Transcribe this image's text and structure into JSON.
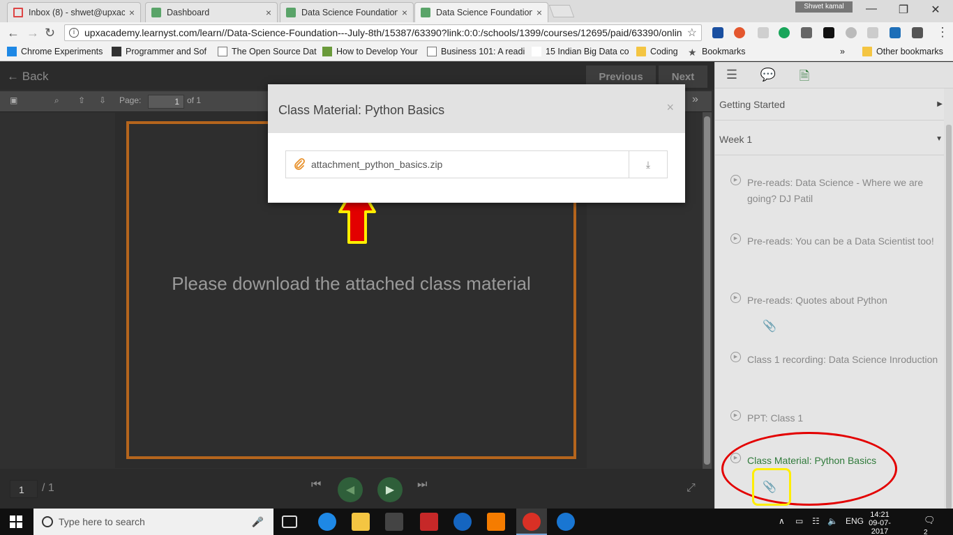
{
  "browser": {
    "tabs": [
      {
        "title": "Inbox (8) - shwet@upxac",
        "icon": "gmail-icon"
      },
      {
        "title": "Dashboard",
        "icon": "learnyst-icon"
      },
      {
        "title": "Data Science Foundation",
        "icon": "learnyst-icon"
      },
      {
        "title": "Data Science Foundation",
        "icon": "learnyst-icon"
      }
    ],
    "close_glyph": "×",
    "user_badge": "Shwet kamal",
    "url": "upxacademy.learnyst.com/learn//Data-Science-Foundation---July-8th/15387/63390?link:0:0:/schools/1399/courses/12695/paid/63390/onlin",
    "bookmarks": [
      {
        "label": "Chrome Experiments",
        "icon": "ce"
      },
      {
        "label": "Programmer and Sof",
        "icon": "dark"
      },
      {
        "label": "The Open Source Dat",
        "icon": "page"
      },
      {
        "label": "How to Develop Your",
        "icon": "hl"
      },
      {
        "label": "Business 101: A readi",
        "icon": "page"
      },
      {
        "label": "15 Indian Big Data co",
        "icon": "ys"
      },
      {
        "label": "Coding",
        "icon": "folder"
      },
      {
        "label": "Bookmarks",
        "icon": "starbm"
      }
    ],
    "bookmarks_more": "»",
    "other_bookmarks": "Other bookmarks"
  },
  "viewer": {
    "back_label": "Back",
    "previous_label": "Previous",
    "next_label": "Next",
    "page_label": "Page:",
    "page_value": "1",
    "page_of": "of 1",
    "slide_text": "Please download the attached class material",
    "bottom_page": "1",
    "bottom_of": "/ 1"
  },
  "sidebar": {
    "sections": [
      {
        "label": "Getting Started",
        "arrow": "▶"
      },
      {
        "label": "Week 1",
        "arrow": "▼"
      }
    ],
    "items": [
      {
        "label": "Pre-reads: Data Science - Where we are going? DJ Patil"
      },
      {
        "label": "Pre-reads: You can be a Data Scientist too!"
      },
      {
        "label": "Pre-reads: Quotes about Python"
      },
      {
        "label": "Class 1 recording: Data Science Inroduction"
      },
      {
        "label": "PPT: Class 1"
      },
      {
        "label": "Class Material: Python Basics"
      }
    ]
  },
  "modal": {
    "title": "Class Material: Python Basics",
    "close": "×",
    "attachment": "attachment_python_basics.zip"
  },
  "taskbar": {
    "search_placeholder": "Type here to search",
    "lang": "ENG",
    "time": "14:21",
    "date": "09-07-2017",
    "notifications": "2"
  },
  "colors": {
    "accent_green": "#2f7a3a",
    "slide_border": "#b5651d",
    "annotation_red": "#e30000",
    "annotation_yellow": "#ffee00"
  }
}
